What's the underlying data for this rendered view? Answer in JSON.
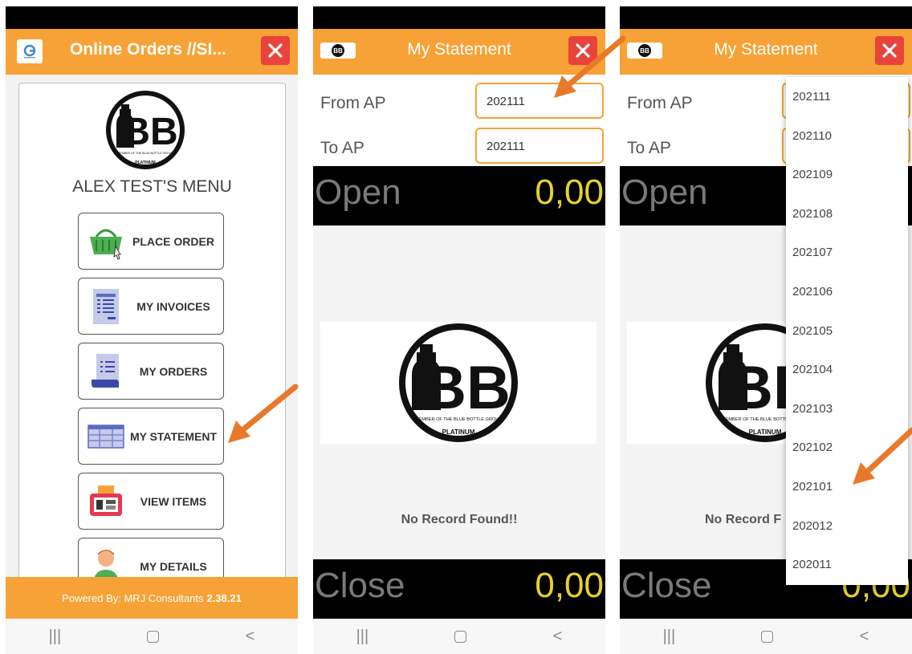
{
  "screen1": {
    "title": "Online Orders //SI...",
    "menu_title": "ALEX TEST'S MENU",
    "menu_items": [
      {
        "label": "PLACE ORDER",
        "icon": "basket-icon"
      },
      {
        "label": "MY INVOICES",
        "icon": "invoice-icon"
      },
      {
        "label": "MY ORDERS",
        "icon": "orders-icon"
      },
      {
        "label": "MY STATEMENT",
        "icon": "statement-icon"
      },
      {
        "label": "VIEW ITEMS",
        "icon": "items-icon"
      },
      {
        "label": "MY DETAILS",
        "icon": "person-icon"
      }
    ],
    "footer_text": "Powered By: MRJ Consultants",
    "footer_version": "2.38.21"
  },
  "screen2": {
    "title": "My Statement",
    "from_label": "From AP",
    "from_value": "202111",
    "to_label": "To AP",
    "to_value": "202111",
    "open_label": "Open",
    "open_amount": "0,00",
    "close_label": "Close",
    "close_amount": "0,00",
    "no_record": "No Record Found!!"
  },
  "screen3": {
    "title": "My Statement",
    "from_label": "From AP",
    "to_label": "To AP",
    "open_label": "Open",
    "close_label": "Close",
    "close_amount_partial": "0,00",
    "no_record_partial": "No Record F",
    "dropdown_options": [
      "202111",
      "202110",
      "202109",
      "202108",
      "202107",
      "202106",
      "202105",
      "202104",
      "202103",
      "202102",
      "202101",
      "202012",
      "202011"
    ]
  },
  "logo": {
    "letters": "BB",
    "ring_text": "MEMBER OF THE BLUE BOTTLE GROUP",
    "tier": "PLATINUM"
  },
  "colors": {
    "accent": "#f7a236",
    "close_red": "#e8443b",
    "amount_yellow": "#e6d22a",
    "annotation_arrow": "#e8792b"
  },
  "navbar": {
    "recent": "|||",
    "back": "<"
  }
}
